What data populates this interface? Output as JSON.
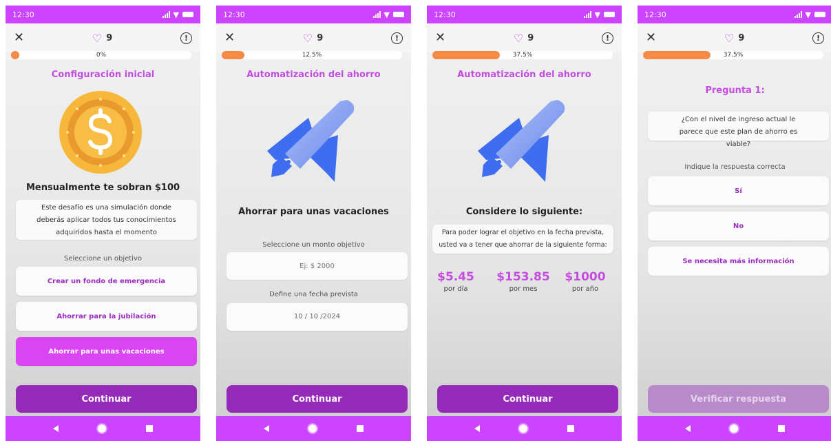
{
  "status_time": "12:30",
  "lives": "9",
  "colors": {
    "accent": "#cc44ff",
    "primary_button": "#952ab9",
    "progress": "#f38b47",
    "title": "#c44de0"
  },
  "screens": [
    {
      "progress": {
        "label": "0%",
        "fraction": 0.0
      },
      "title": "Configuración inicial",
      "image": "coin-dollar",
      "heading": "Mensualmente te sobran $100",
      "description": "Este desafío es una simulación donde deberás aplicar todos tus conocimientos adquiridos hasta el momento",
      "prompt": "Seleccione un objetivo",
      "options": [
        "Crear un fondo de emergencia",
        "Ahorrar para la jubilación",
        "Ahorrar para unas vacaciones"
      ],
      "selected_option": "Ahorrar para unas vacaciones",
      "button": "Continuar"
    },
    {
      "progress": {
        "label": "12.5%",
        "fraction": 0.125
      },
      "title": "Automatización del ahorro",
      "image": "airplane",
      "heading": "Ahorrar para unas vacaciones",
      "amount_label": "Seleccione un monto objetivo",
      "amount_placeholder": "Ej: $ 2000",
      "date_label": "Define una fecha prevista",
      "date_value": "10 / 10 /2024",
      "button": "Continuar"
    },
    {
      "progress": {
        "label": "37.5%",
        "fraction": 0.375
      },
      "title": "Automatización del ahorro",
      "image": "airplane",
      "heading": "Considere lo siguiente:",
      "description": "Para poder lograr el objetivo en la fecha prevista, usted va a tener que ahorrar de la siguiente forma:",
      "amounts": [
        {
          "value": "$5.45",
          "unit": "por día"
        },
        {
          "value": "$153.85",
          "unit": "por mes"
        },
        {
          "value": "$1000",
          "unit": "por año"
        }
      ],
      "button": "Continuar"
    },
    {
      "progress": {
        "label": "37.5%",
        "fraction": 0.375
      },
      "title": "Pregunta 1:",
      "question": "¿Con el nivel de ingreso actual le parece que este plan de ahorro es viable?",
      "prompt": "Indique la respuesta correcta",
      "options": [
        "Sí",
        "No",
        "Se necesita más información"
      ],
      "button": "Verificar respuesta",
      "button_disabled": true
    }
  ]
}
